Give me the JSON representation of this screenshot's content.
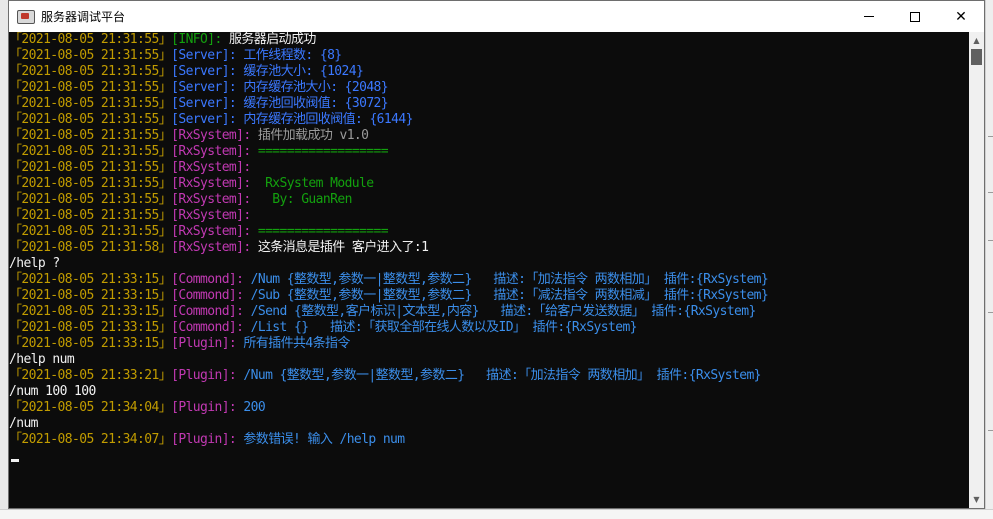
{
  "window": {
    "title": "服务器调试平台",
    "controls": {
      "minimize": "minimize",
      "maximize": "maximize",
      "close": "✕"
    }
  },
  "colors": {
    "timestamp": "#c19c00",
    "info_tag": "#13a10e",
    "server_tag": "#3b78ff",
    "system_tag": "#c239b3",
    "console_bg": "#0c0c0c"
  },
  "console": {
    "lines": [
      [
        {
          "t": "「2021-08-05 21:31:55」",
          "c": "ts"
        },
        {
          "t": "[INFO]: ",
          "c": "t-info"
        },
        {
          "t": "服务器启动成功",
          "c": "m-white"
        }
      ],
      [
        {
          "t": "「2021-08-05 21:31:55」",
          "c": "ts"
        },
        {
          "t": "[Server]: ",
          "c": "t-server"
        },
        {
          "t": "工作线程数: {8}",
          "c": "m-blue"
        }
      ],
      [
        {
          "t": "「2021-08-05 21:31:55」",
          "c": "ts"
        },
        {
          "t": "[Server]: ",
          "c": "t-server"
        },
        {
          "t": "缓存池大小: {1024}",
          "c": "m-blue"
        }
      ],
      [
        {
          "t": "「2021-08-05 21:31:55」",
          "c": "ts"
        },
        {
          "t": "[Server]: ",
          "c": "t-server"
        },
        {
          "t": "内存缓存池大小: {2048}",
          "c": "m-blue"
        }
      ],
      [
        {
          "t": "「2021-08-05 21:31:55」",
          "c": "ts"
        },
        {
          "t": "[Server]: ",
          "c": "t-server"
        },
        {
          "t": "缓存池回收阀值: {3072}",
          "c": "m-blue"
        }
      ],
      [
        {
          "t": "「2021-08-05 21:31:55」",
          "c": "ts"
        },
        {
          "t": "[Server]: ",
          "c": "t-server"
        },
        {
          "t": "内存缓存池回收阀值: {6144}",
          "c": "m-blue"
        }
      ],
      [
        {
          "t": "「2021-08-05 21:31:55」",
          "c": "ts"
        },
        {
          "t": "[RxSystem]: ",
          "c": "t-rx"
        },
        {
          "t": "插件加载成功 v1.0",
          "c": "m-gray"
        }
      ],
      [
        {
          "t": "「2021-08-05 21:31:55」",
          "c": "ts"
        },
        {
          "t": "[RxSystem]: ",
          "c": "t-rx"
        },
        {
          "t": "==================",
          "c": "m-green"
        }
      ],
      [
        {
          "t": "「2021-08-05 21:31:55」",
          "c": "ts"
        },
        {
          "t": "[RxSystem]: ",
          "c": "t-rx"
        }
      ],
      [
        {
          "t": "「2021-08-05 21:31:55」",
          "c": "ts"
        },
        {
          "t": "[RxSystem]: ",
          "c": "t-rx"
        },
        {
          "t": " RxSystem Module",
          "c": "m-green"
        }
      ],
      [
        {
          "t": "「2021-08-05 21:31:55」",
          "c": "ts"
        },
        {
          "t": "[RxSystem]: ",
          "c": "t-rx"
        },
        {
          "t": "  By: GuanRen",
          "c": "m-green"
        }
      ],
      [
        {
          "t": "「2021-08-05 21:31:55」",
          "c": "ts"
        },
        {
          "t": "[RxSystem]: ",
          "c": "t-rx"
        }
      ],
      [
        {
          "t": "「2021-08-05 21:31:55」",
          "c": "ts"
        },
        {
          "t": "[RxSystem]: ",
          "c": "t-rx"
        },
        {
          "t": "==================",
          "c": "m-green"
        }
      ],
      [
        {
          "t": "「2021-08-05 21:31:58」",
          "c": "ts"
        },
        {
          "t": "[RxSystem]: ",
          "c": "t-rx"
        },
        {
          "t": "这条消息是插件 客户进入了:1",
          "c": "m-white"
        }
      ],
      [
        {
          "t": "/help ?",
          "c": "m-white"
        }
      ],
      [
        {
          "t": "「2021-08-05 21:33:15」",
          "c": "ts"
        },
        {
          "t": "[Commond]: ",
          "c": "t-cmd"
        },
        {
          "t": "/Num {整数型,参数一|整数型,参数二}   描述:「加法指令 两数相加」 插件:{RxSystem}",
          "c": "m-cyan"
        }
      ],
      [
        {
          "t": "「2021-08-05 21:33:15」",
          "c": "ts"
        },
        {
          "t": "[Commond]: ",
          "c": "t-cmd"
        },
        {
          "t": "/Sub {整数型,参数一|整数型,参数二}   描述:「减法指令 两数相减」 插件:{RxSystem}",
          "c": "m-cyan"
        }
      ],
      [
        {
          "t": "「2021-08-05 21:33:15」",
          "c": "ts"
        },
        {
          "t": "[Commond]: ",
          "c": "t-cmd"
        },
        {
          "t": "/Send {整数型,客户标识|文本型,内容}   描述:「给客户发送数据」 插件:{RxSystem}",
          "c": "m-cyan"
        }
      ],
      [
        {
          "t": "「2021-08-05 21:33:15」",
          "c": "ts"
        },
        {
          "t": "[Commond]: ",
          "c": "t-cmd"
        },
        {
          "t": "/List {}   描述:「获取全部在线人数以及ID」 插件:{RxSystem}",
          "c": "m-cyan"
        }
      ],
      [
        {
          "t": "「2021-08-05 21:33:15」",
          "c": "ts"
        },
        {
          "t": "[Plugin]: ",
          "c": "t-plugin"
        },
        {
          "t": "所有插件共4条指令",
          "c": "m-cyan"
        }
      ],
      [
        {
          "t": "/help num",
          "c": "m-white"
        }
      ],
      [
        {
          "t": "「2021-08-05 21:33:21」",
          "c": "ts"
        },
        {
          "t": "[Plugin]: ",
          "c": "t-plugin"
        },
        {
          "t": "/Num {整数型,参数一|整数型,参数二}   描述:「加法指令 两数相加」 插件:{RxSystem}",
          "c": "m-cyan"
        }
      ],
      [
        {
          "t": "/num 100 100",
          "c": "m-white"
        }
      ],
      [
        {
          "t": "「2021-08-05 21:34:04」",
          "c": "ts"
        },
        {
          "t": "[Plugin]: ",
          "c": "t-plugin"
        },
        {
          "t": "200",
          "c": "m-cyan"
        }
      ],
      [
        {
          "t": "/num",
          "c": "m-white"
        }
      ],
      [
        {
          "t": "「2021-08-05 21:34:07」",
          "c": "ts"
        },
        {
          "t": "[Plugin]: ",
          "c": "t-plugin"
        },
        {
          "t": "参数错误! 输入 /help num",
          "c": "m-cyan"
        }
      ]
    ]
  },
  "scrollbar": {
    "up_arrow": "▲",
    "down_arrow": "▼"
  }
}
